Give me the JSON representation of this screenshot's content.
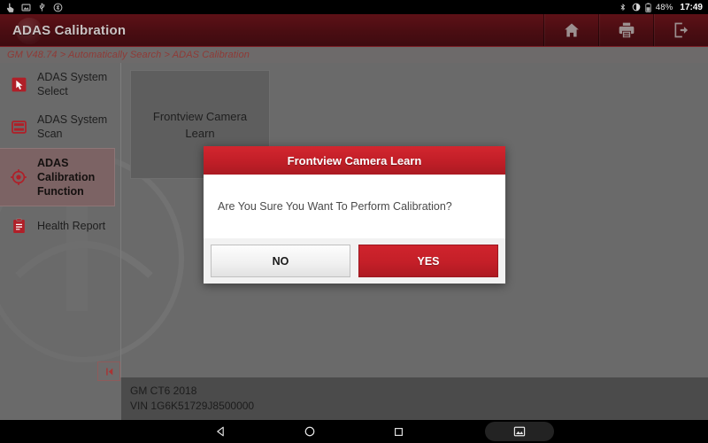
{
  "statusbar": {
    "left_icons": [
      "touch-pointer-icon",
      "screenshot-icon",
      "usb-icon",
      "bluetooth-settings-icon"
    ],
    "right_icons": [
      "bluetooth-icon",
      "brightness-icon",
      "battery-icon"
    ],
    "battery_percent": "48%",
    "time": "17:49"
  },
  "titlebar": {
    "title": "ADAS Calibration",
    "actions": [
      {
        "name": "home-button",
        "icon": "home-icon"
      },
      {
        "name": "print-button",
        "icon": "printer-icon"
      },
      {
        "name": "exit-button",
        "icon": "exit-icon"
      }
    ]
  },
  "breadcrumb": {
    "text": "GM V48.74 > Automatically Search > ADAS Calibration"
  },
  "sidebar": {
    "items": [
      {
        "label": "ADAS System Select",
        "icon": "cursor-select-icon",
        "active": false
      },
      {
        "label": "ADAS System Scan",
        "icon": "system-scan-icon",
        "active": false
      },
      {
        "label": "ADAS Calibration Function",
        "icon": "target-crosshair-icon",
        "active": true
      },
      {
        "label": "Health Report",
        "icon": "clipboard-report-icon",
        "active": false
      }
    ],
    "collapse_label": "collapse-sidebar"
  },
  "main": {
    "cards": [
      {
        "label": "Frontview Camera Learn"
      }
    ]
  },
  "vehicle": {
    "model": "GM CT6 2018",
    "vin": "VIN 1G6K51729J8500000"
  },
  "dialog": {
    "title": "Frontview Camera Learn",
    "message": "Are You Sure You Want To Perform Calibration?",
    "no_label": "NO",
    "yes_label": "YES"
  },
  "navbar": {
    "buttons": [
      {
        "name": "nav-back-button",
        "icon": "triangle-back-icon"
      },
      {
        "name": "nav-home-button",
        "icon": "circle-home-icon"
      },
      {
        "name": "nav-recents-button",
        "icon": "square-recents-icon"
      },
      {
        "name": "nav-screenshot-button",
        "icon": "image-screenshot-icon"
      }
    ]
  },
  "colors": {
    "brand_red": "#c41f28",
    "titlebar_dark_red": "#4a0d12",
    "page_gray": "#6a6a6a",
    "info_gray": "#4b4b4b"
  }
}
